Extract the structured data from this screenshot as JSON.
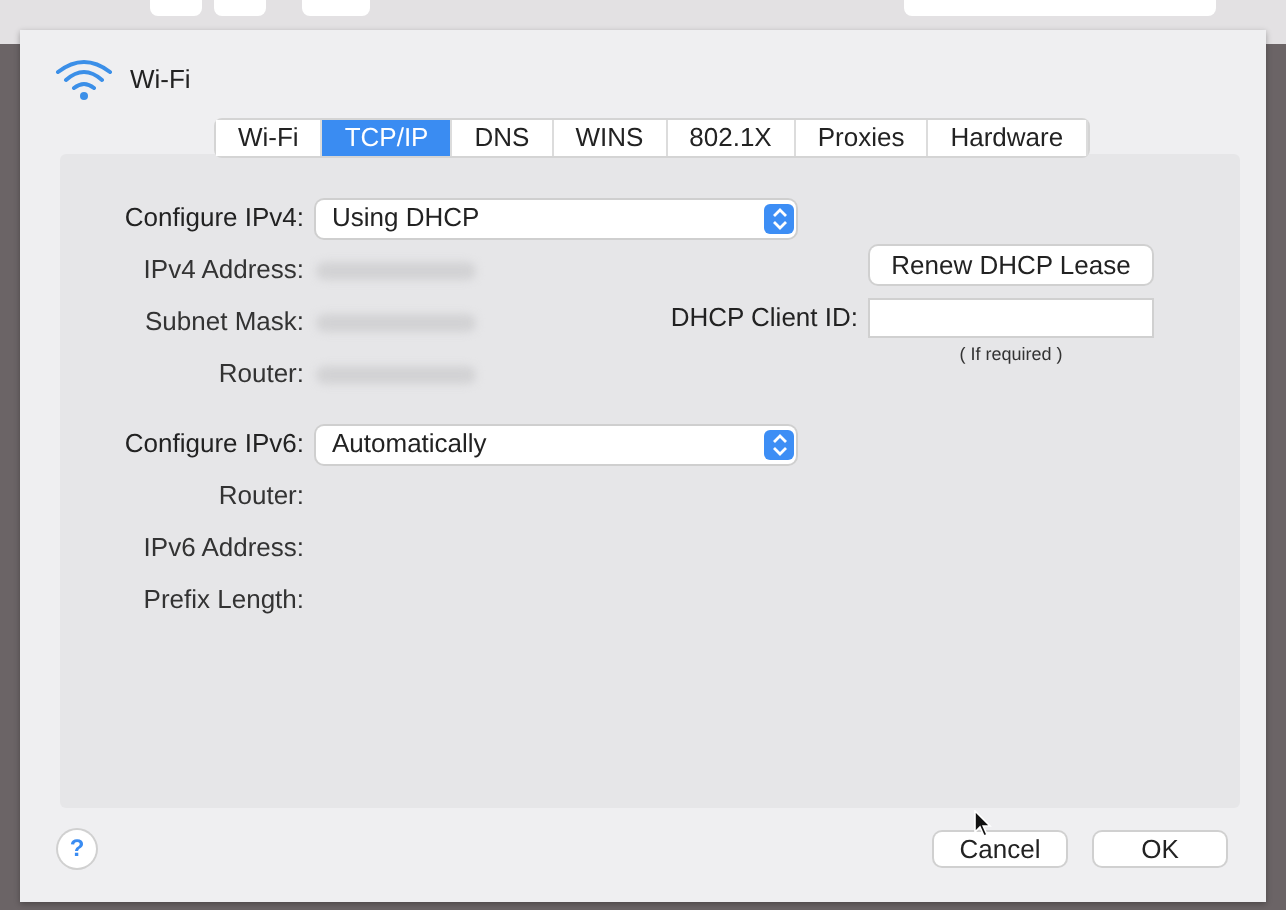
{
  "header": {
    "label": "Wi-Fi"
  },
  "tabs": [
    {
      "label": "Wi-Fi",
      "selected": false
    },
    {
      "label": "TCP/IP",
      "selected": true
    },
    {
      "label": "DNS",
      "selected": false
    },
    {
      "label": "WINS",
      "selected": false
    },
    {
      "label": "802.1X",
      "selected": false
    },
    {
      "label": "Proxies",
      "selected": false
    },
    {
      "label": "Hardware",
      "selected": false
    }
  ],
  "ipv4": {
    "configure": {
      "label": "Configure IPv4:",
      "value": "Using DHCP"
    },
    "fields": [
      {
        "label": "IPv4 Address:",
        "redacted": true
      },
      {
        "label": "Subnet Mask:",
        "redacted": true
      },
      {
        "label": "Router:",
        "redacted": true
      }
    ]
  },
  "renew_button": "Renew DHCP Lease",
  "client_id": {
    "label": "DHCP Client ID:",
    "hint": "( If required )"
  },
  "ipv6": {
    "configure": {
      "label": "Configure IPv6:",
      "value": "Automatically"
    },
    "fields": [
      {
        "label": "Router:",
        "redacted": false
      },
      {
        "label": "IPv6 Address:",
        "redacted": false
      },
      {
        "label": "Prefix Length:",
        "redacted": false
      }
    ]
  },
  "help": "?",
  "buttons": [
    "Cancel",
    "OK"
  ]
}
